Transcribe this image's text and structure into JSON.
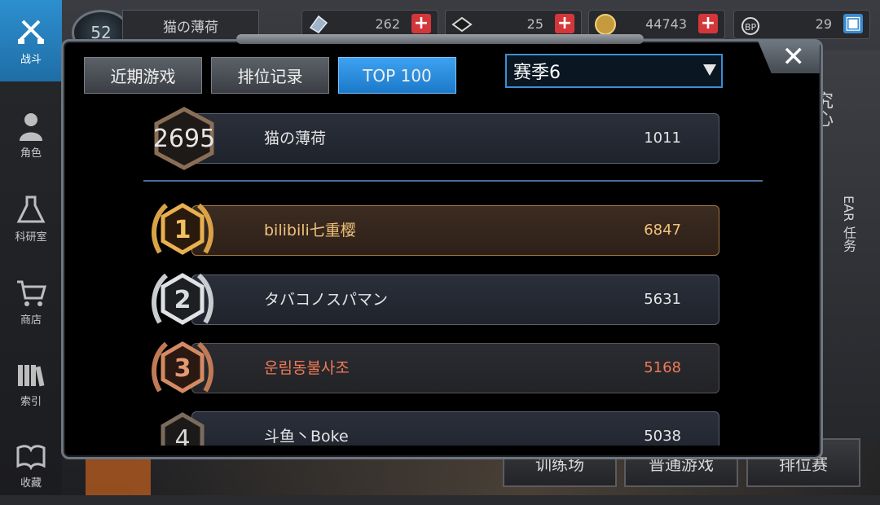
{
  "sidebar": {
    "items": [
      {
        "label": "战斗",
        "icon": "crossed-guns-icon",
        "active": true
      },
      {
        "label": "角色",
        "icon": "character-icon"
      },
      {
        "label": "科研室",
        "icon": "flask-icon"
      },
      {
        "label": "商店",
        "icon": "cart-icon"
      },
      {
        "label": "索引",
        "icon": "books-icon"
      },
      {
        "label": "收藏",
        "icon": "open-book-icon"
      }
    ]
  },
  "header": {
    "level": "52",
    "player_name": "猫の薄荷",
    "resources": [
      {
        "name": "crystal",
        "icon": "crystal-icon",
        "value": "262",
        "action": "+"
      },
      {
        "name": "ticket",
        "icon": "ticket-icon",
        "value": "25",
        "action": "+"
      },
      {
        "name": "coin",
        "icon": "coin-icon",
        "value": "44743",
        "action": "+"
      },
      {
        "name": "bp",
        "icon": "bp-paw-icon",
        "value": "29",
        "action": "▣"
      }
    ]
  },
  "background": {
    "right_panel_text_1": "究心",
    "right_panel_text_2": "EAR 任务",
    "bottom_buttons": [
      "训练场",
      "普通游戏",
      "排位赛"
    ]
  },
  "modal": {
    "close_label": "✕",
    "tabs": [
      {
        "label": "近期游戏",
        "active": false
      },
      {
        "label": "排位记录",
        "active": false
      },
      {
        "label": "TOP 100",
        "active": true
      }
    ],
    "season_select": {
      "value": "赛季6"
    },
    "my_rank": {
      "rank": "2695",
      "name": "猫の薄荷",
      "score": "1011"
    },
    "leaderboard": [
      {
        "rank": "1",
        "name": "bilibili七重樱",
        "score": "6847",
        "tier": "gold"
      },
      {
        "rank": "2",
        "name": "タバコノスパマン",
        "score": "5631",
        "tier": "silver"
      },
      {
        "rank": "3",
        "name": "운림동불사조",
        "score": "5168",
        "tier": "bronze"
      },
      {
        "rank": "4",
        "name": "斗鱼丶Boke",
        "score": "5038",
        "tier": "normal"
      }
    ]
  },
  "colors": {
    "accent_blue": "#2d8fcf",
    "gold": "#f0c27a",
    "silver": "#cfd3d8",
    "bronze": "#f07a54"
  }
}
